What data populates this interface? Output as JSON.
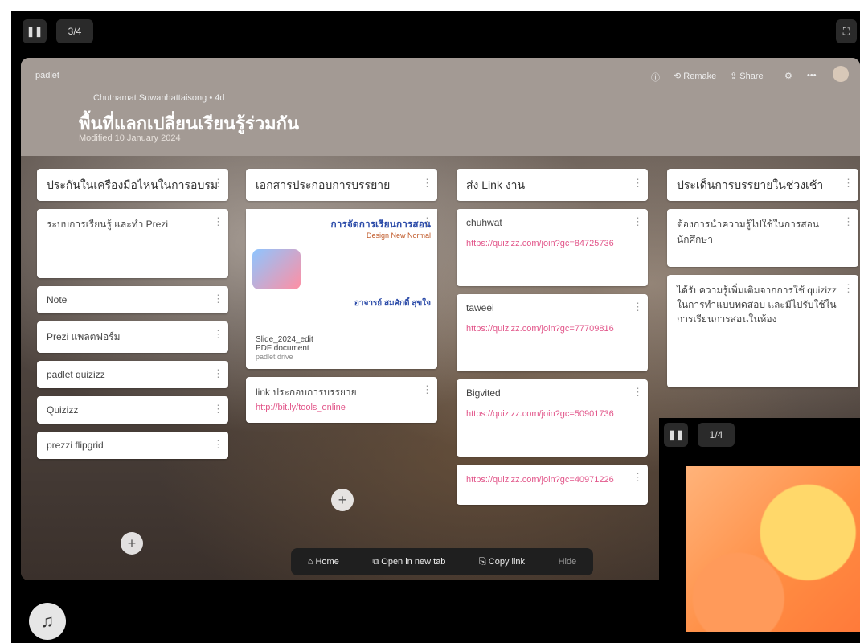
{
  "topbar": {
    "left_icon": "pause-icon",
    "left_label": "3/4",
    "right_icon": "fullscreen-icon"
  },
  "header": {
    "byline": "Chuthamat Suwanhattaisong • 4d",
    "title": "พื้นที่แลกเปลี่ยนเรียนรู้ร่วมกัน",
    "subtitle": "Modified 10 January 2024"
  },
  "columns": [
    {
      "heading": "ประกันในเครื่องมือไหนในการอบรม",
      "cards": [
        {
          "text": "ระบบการเรียนรู้ และทำ Prezi"
        },
        {
          "text": "Note"
        },
        {
          "text": "Prezi แพลตฟอร์ม"
        },
        {
          "text": "padlet quizizz"
        },
        {
          "text": "Quizizz"
        },
        {
          "text": "prezzi flipgrid"
        }
      ]
    },
    {
      "heading": "เอกสารประกอบการบรรยาย",
      "doc": {
        "slide_title": "การจัดการเรียนการสอน",
        "slide_sub": "Design New Normal",
        "slide_author": "อาจารย์ สมศักดิ์ สุขใจ",
        "file_name": "Slide_2024_edit",
        "file_type": "PDF document",
        "file_src": "padlet drive"
      },
      "link_card": {
        "text": "link ประกอบการบรรยาย",
        "url": "http://bit.ly/tools_online"
      }
    },
    {
      "heading": "ส่ง Link งาน",
      "cards": [
        {
          "name": "chuhwat",
          "url": "https://quizizz.com/join?gc=84725736"
        },
        {
          "name": "taweei",
          "url": "https://quizizz.com/join?gc=77709816"
        },
        {
          "name": "Bigvited",
          "url": "https://quizizz.com/join?gc=50901736"
        },
        {
          "name": "",
          "url": "https://quizizz.com/join?gc=40971226"
        }
      ]
    },
    {
      "heading": "ประเด็นการบรรยายในช่วงเช้า",
      "cards": [
        {
          "text": "ต้องการนำความรู้ไปใช้ในการสอนนักศึกษา"
        },
        {
          "text": "ได้รับความรู้เพิ่มเติมจากการใช้ quizizz ในการทำแบบทดสอบ และมีไปรับใช้ในการเรียนการสอนในห้อง"
        }
      ]
    }
  ],
  "footer": {
    "home": "Home",
    "open": "Open in new tab",
    "copy": "Copy link",
    "hide": "Hide"
  },
  "pip": {
    "pause_icon": "pause-icon",
    "label": "1/4"
  },
  "music": {
    "icon": "music-icon"
  },
  "colors": {
    "link": "#e2568a",
    "slide_orange": "#ff8c42"
  }
}
